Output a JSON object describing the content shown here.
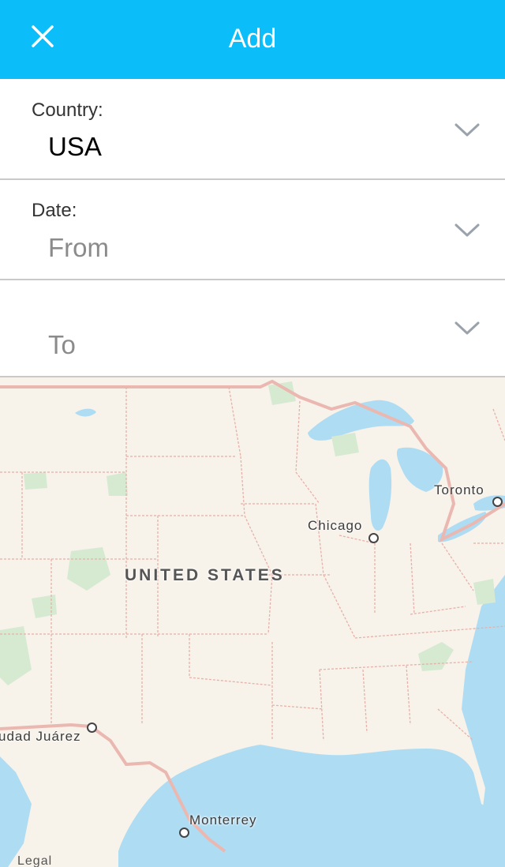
{
  "header": {
    "title": "Add",
    "close_icon": "close-icon",
    "background_color": "#0bbdf9"
  },
  "country_row": {
    "label": "Country:",
    "value": "USA",
    "icon": "chevron-down-icon"
  },
  "date_from_row": {
    "label": "Date:",
    "placeholder": "From",
    "icon": "chevron-down-icon"
  },
  "date_to_row": {
    "placeholder": "To",
    "icon": "chevron-down-icon"
  },
  "map": {
    "country_label": "UNITED STATES",
    "cities": [
      {
        "name": "Chicago"
      },
      {
        "name": "Toronto"
      },
      {
        "name": "udad Juárez"
      },
      {
        "name": "Monterrey"
      }
    ],
    "legal": "Legal",
    "colors": {
      "land": "#f7f2ea",
      "water": "#aedcf3",
      "border": "#e8a39a",
      "park": "#d5ead1"
    }
  }
}
